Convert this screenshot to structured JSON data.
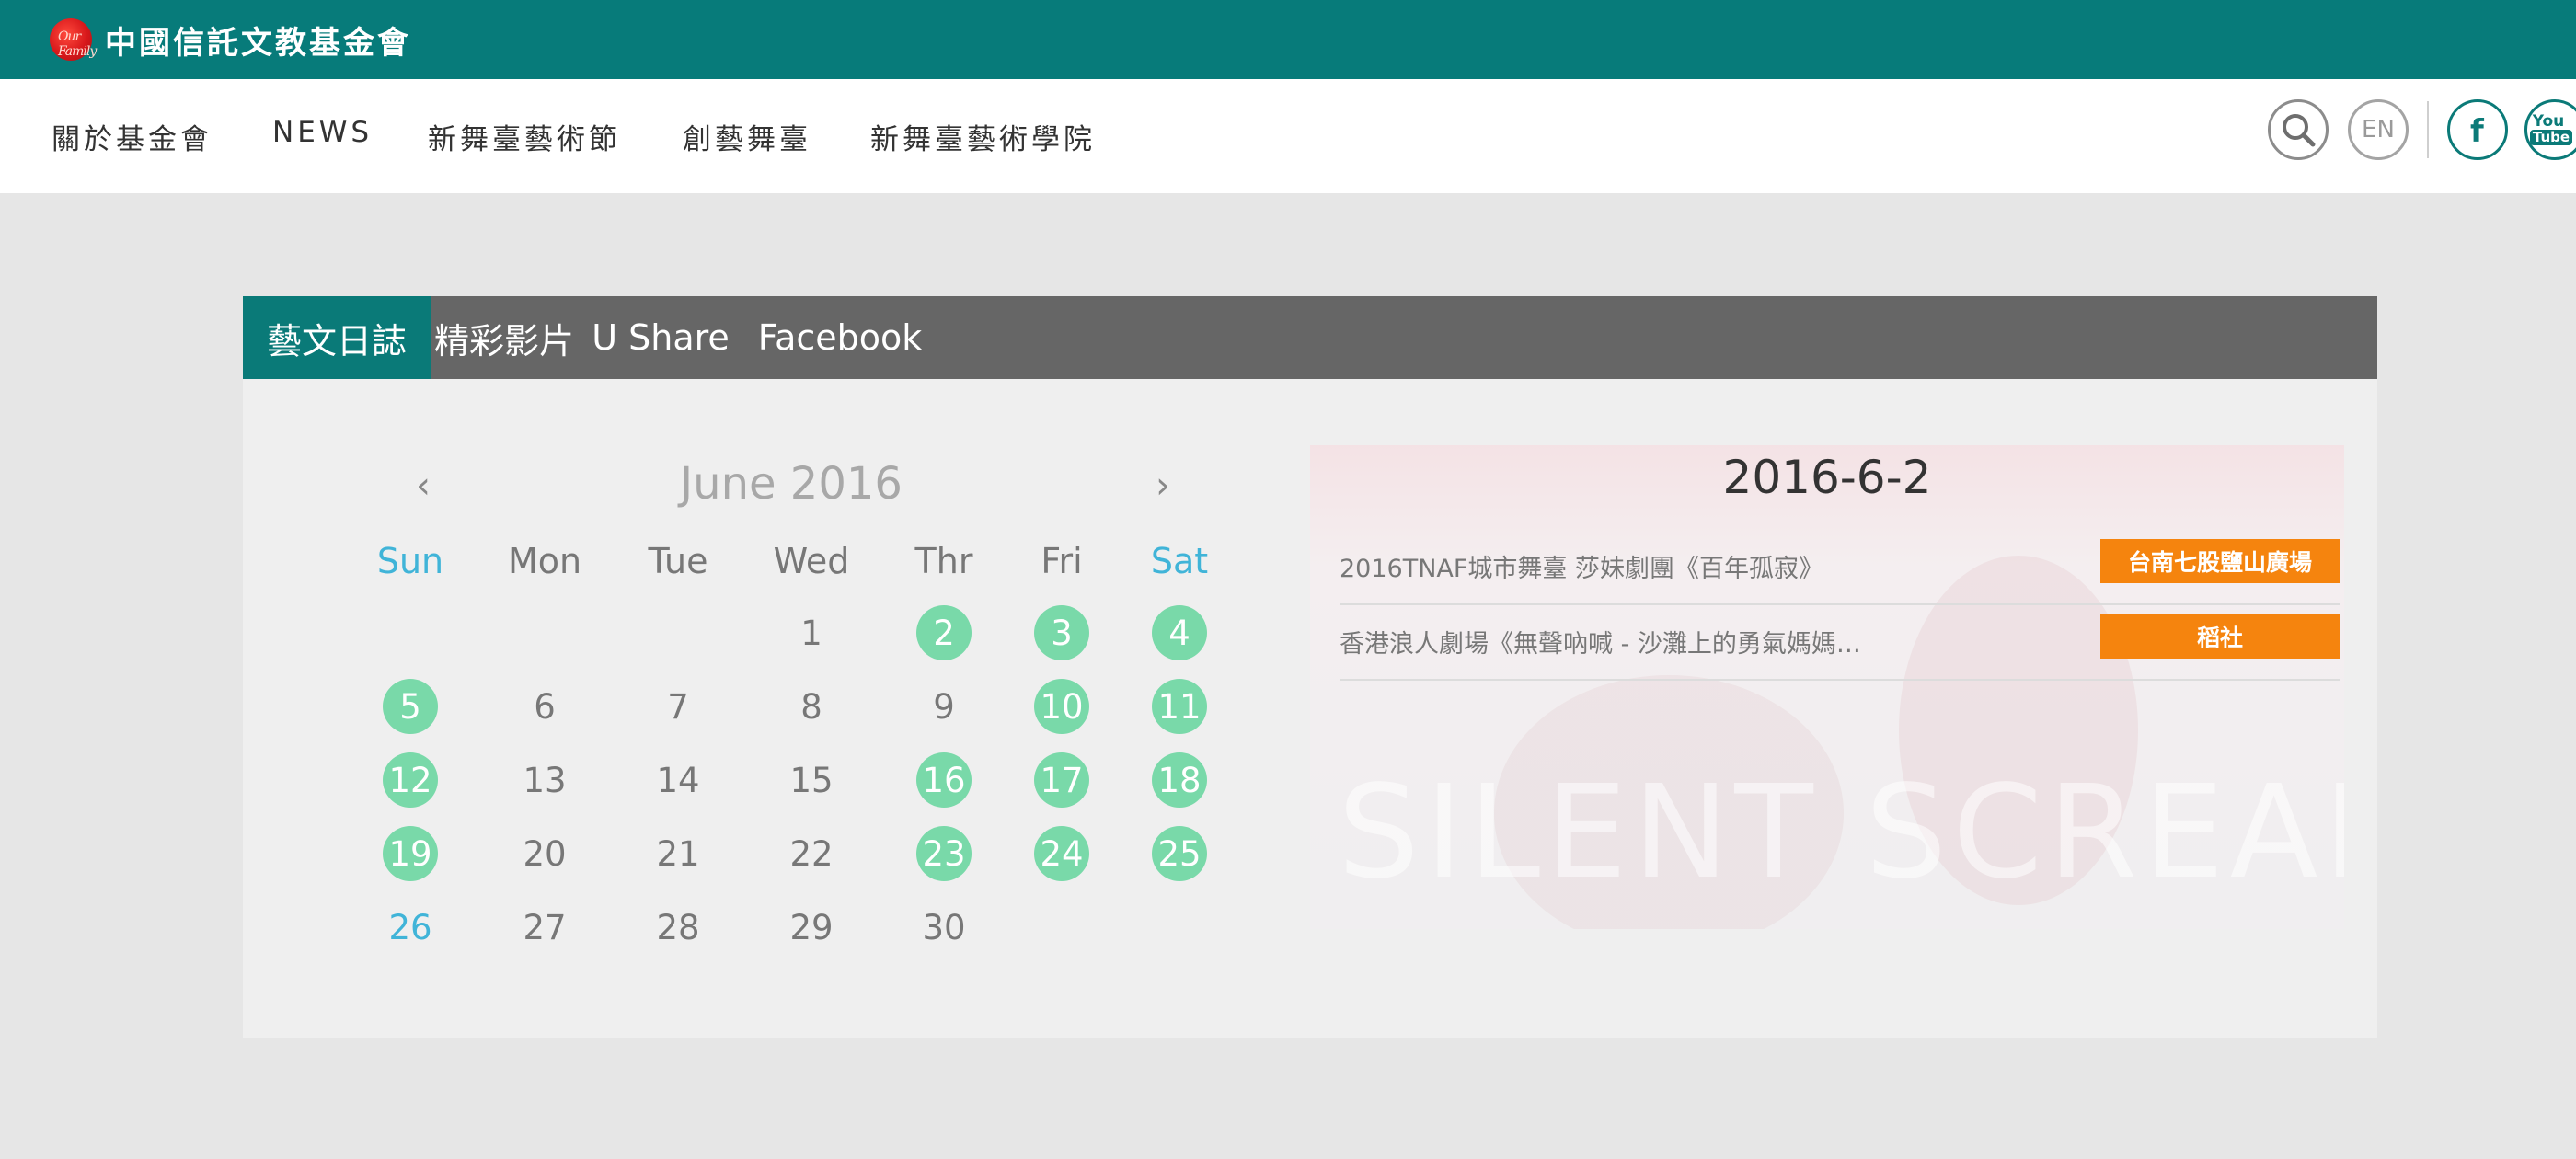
{
  "header": {
    "logo_text": "中國信託文教基金會",
    "logo_badge_text": "Our Family"
  },
  "nav": {
    "items": [
      "關於基金會",
      "NEWS",
      "新舞臺藝術節",
      "創藝舞臺",
      "新舞臺藝術學院"
    ],
    "icons": [
      "search-icon",
      "language-en-icon",
      "facebook-icon",
      "youtube-icon"
    ],
    "lang_label": "EN",
    "youtube_label_top": "You",
    "youtube_label_bottom": "Tube"
  },
  "tabs": [
    "藝文日誌",
    "精彩影片",
    "U Share",
    "Facebook"
  ],
  "calendar": {
    "month_title": "June 2016",
    "prev_label": "‹",
    "next_label": "›",
    "weekdays": [
      "Sun",
      "Mon",
      "Tue",
      "Wed",
      "Thr",
      "Fri",
      "Sat"
    ],
    "weeks": [
      [
        "",
        "",
        "",
        "1",
        "2",
        "3",
        "4"
      ],
      [
        "5",
        "6",
        "7",
        "8",
        "9",
        "10",
        "11"
      ],
      [
        "12",
        "13",
        "14",
        "15",
        "16",
        "17",
        "18"
      ],
      [
        "19",
        "20",
        "21",
        "22",
        "23",
        "24",
        "25"
      ],
      [
        "26",
        "27",
        "28",
        "29",
        "30",
        "",
        ""
      ]
    ],
    "event_days": [
      "2",
      "3",
      "4",
      "5",
      "10",
      "11",
      "12",
      "16",
      "17",
      "18",
      "19",
      "23",
      "24",
      "25"
    ]
  },
  "events": {
    "date": "2016-6-2",
    "items": [
      {
        "title": "2016TNAF城市舞臺 莎妹劇團《百年孤寂》",
        "venue": "台南七股鹽山廣場"
      },
      {
        "title": "香港浪人劇場《無聲吶喊 - 沙灘上的勇氣媽媽…",
        "venue": "稻社"
      }
    ],
    "background_text": "SILENT SCREAM"
  },
  "colors": {
    "brand_teal": "#077b7a",
    "tab_bar": "#666666",
    "event_day": "#79d9a9",
    "weekend_text": "#40b4d8",
    "venue_tag": "#f5840e"
  }
}
